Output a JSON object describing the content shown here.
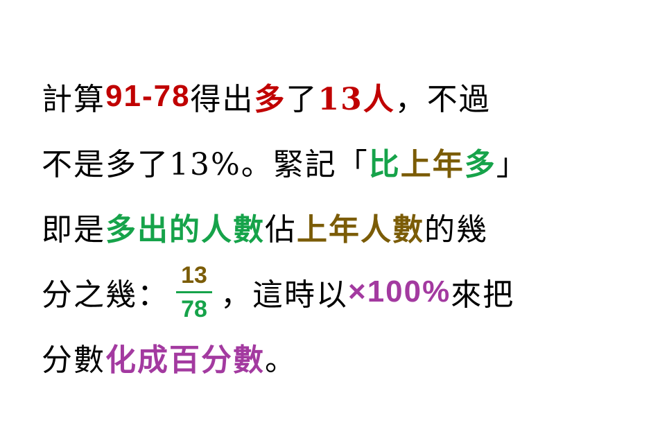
{
  "lines": [
    {
      "segments": [
        {
          "text": "計算",
          "style": "plain"
        },
        {
          "text": "91-78",
          "style": "red"
        },
        {
          "text": "得出",
          "style": "plain"
        },
        {
          "text": "多",
          "style": "red"
        },
        {
          "text": "了",
          "style": "plain"
        },
        {
          "text": "13人",
          "style": "red"
        },
        {
          "text": "，不過",
          "style": "plain"
        }
      ]
    },
    {
      "segments": [
        {
          "text": "不是多了13%。緊記「",
          "style": "plain"
        },
        {
          "text": "比",
          "style": "green"
        },
        {
          "text": "上年",
          "style": "olive"
        },
        {
          "text": "多",
          "style": "green"
        },
        {
          "text": "」",
          "style": "plain"
        }
      ]
    },
    {
      "segments": [
        {
          "text": "即是",
          "style": "plain"
        },
        {
          "text": "多出的人數",
          "style": "green"
        },
        {
          "text": "佔",
          "style": "plain"
        },
        {
          "text": "上年人數",
          "style": "olive"
        },
        {
          "text": "的幾",
          "style": "plain"
        }
      ]
    },
    {
      "segments": [
        {
          "text": "分之幾：",
          "style": "plain"
        },
        {
          "text": "，這時以",
          "style": "plain"
        },
        {
          "text": "×100%",
          "style": "purple"
        },
        {
          "text": "來把",
          "style": "plain"
        }
      ],
      "fraction": {
        "numerator": "13",
        "denominator": "78"
      }
    },
    {
      "segments": [
        {
          "text": "分數",
          "style": "plain"
        },
        {
          "text": "化成百分數",
          "style": "purple"
        },
        {
          "text": "。",
          "style": "plain"
        }
      ]
    }
  ],
  "colors": {
    "text": "#000000",
    "red": "#c00000",
    "green": "#16a34a",
    "olive": "#7b5c07",
    "purple": "#a33aa0",
    "background": "#ffffff"
  }
}
